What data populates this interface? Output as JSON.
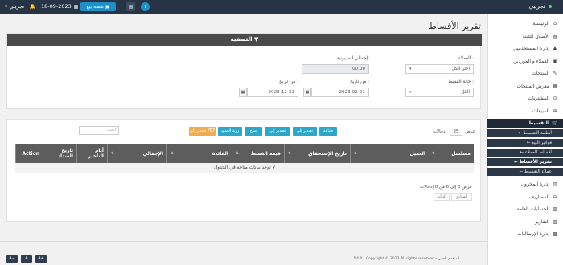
{
  "topbar": {
    "brand": "تجريبي",
    "user": "تجريبي",
    "date": "18-09-2023",
    "pos_button": "نقطة بيع"
  },
  "sidebar": {
    "items": [
      {
        "label": "الرئيسية",
        "icon": "home-icon",
        "glyph": "⌂"
      },
      {
        "label": "الأصول الثابتة",
        "icon": "assets-icon",
        "glyph": "▤"
      },
      {
        "label": "إدارة المستخدمين",
        "icon": "users-icon",
        "glyph": "♟"
      },
      {
        "label": "العملاء و الموردين",
        "icon": "contacts-icon",
        "glyph": "▣"
      },
      {
        "label": "المنتجات",
        "icon": "products-icon",
        "glyph": "✎"
      },
      {
        "label": "معرض المنتجات",
        "icon": "gallery-icon",
        "glyph": "▦"
      },
      {
        "label": "المشتريات",
        "icon": "purchases-icon",
        "glyph": "⊙"
      },
      {
        "label": "المبيعات",
        "icon": "sales-icon",
        "glyph": "⊕"
      }
    ],
    "active": {
      "label": "التقسيط",
      "icon": "cart-icon",
      "glyph": "🛒"
    },
    "subitems": [
      {
        "label": "أنظمة التقسيط"
      },
      {
        "label": "فواتير البيع"
      },
      {
        "label": "أقساط العملاء"
      },
      {
        "label": "تقرير الأقساط"
      },
      {
        "label": "عملاء التقسيط"
      }
    ],
    "items_after": [
      {
        "label": "إدارة المخزون",
        "icon": "inventory-icon",
        "glyph": "▥"
      },
      {
        "label": "المصاريف",
        "icon": "expenses-icon",
        "glyph": "⊖"
      },
      {
        "label": "الحسابات العامة",
        "icon": "accounts-icon",
        "glyph": "▧"
      },
      {
        "label": "التقارير",
        "icon": "reports-icon",
        "glyph": "▨"
      },
      {
        "label": "إدارة الإرساليات",
        "icon": "shipping-icon",
        "glyph": "▩"
      }
    ]
  },
  "page": {
    "title": "تقرير الأقساط"
  },
  "filter": {
    "header": "التصفية",
    "customer_label": "العملاء :",
    "customer_value": "اختر الكل",
    "debt_label": "إجمالي المديونية:",
    "debt_value": "00.00",
    "status_label": "حالة القسط :",
    "status_value": "الكل",
    "from_label": "من تاريخ :",
    "from_value": "2023-01-01",
    "to_label": "من تاريخ :",
    "to_value": "2023-12-31"
  },
  "table_controls": {
    "show_label": "عرض",
    "show_value": "25",
    "entries_label": "إدخالات",
    "search_placeholder": "ابحث",
    "buttons": {
      "print": "طباعة",
      "csv": "تصدير إلى CSV",
      "excel": "تصدير إلى Excel",
      "copy": "نسخ",
      "visibility": "رؤية العمود",
      "pdf": "تصدير إلى PDF"
    }
  },
  "table": {
    "columns": [
      "مسلسل",
      "العميل",
      "تاريخ الإستحقاق",
      "قيمة القسط",
      "الفائدة",
      "الإجمالي",
      "أيام التأخير",
      "تاريخ السداد",
      "Action"
    ],
    "empty_message": "لا توجد بيانات متاحة في الجدول",
    "info": "عرض 0 إلى 0 من 0 إدخالات",
    "prev": "السابق",
    "next": "التالي"
  },
  "footer": {
    "font_minus": "A−",
    "font_reset": "A",
    "font_plus": "A+",
    "copyright": "V4.0 | Copyright © 2023 All rights reserved - المتقدم الحلي"
  },
  "colors": {
    "topbar": "#263445",
    "sidebar_active": "#1f2a36",
    "filter_header": "#4a4a4a",
    "table_header": "#5d5d5d",
    "btn_blue": "#2aa7c9",
    "btn_orange": "#f0ad4e"
  }
}
